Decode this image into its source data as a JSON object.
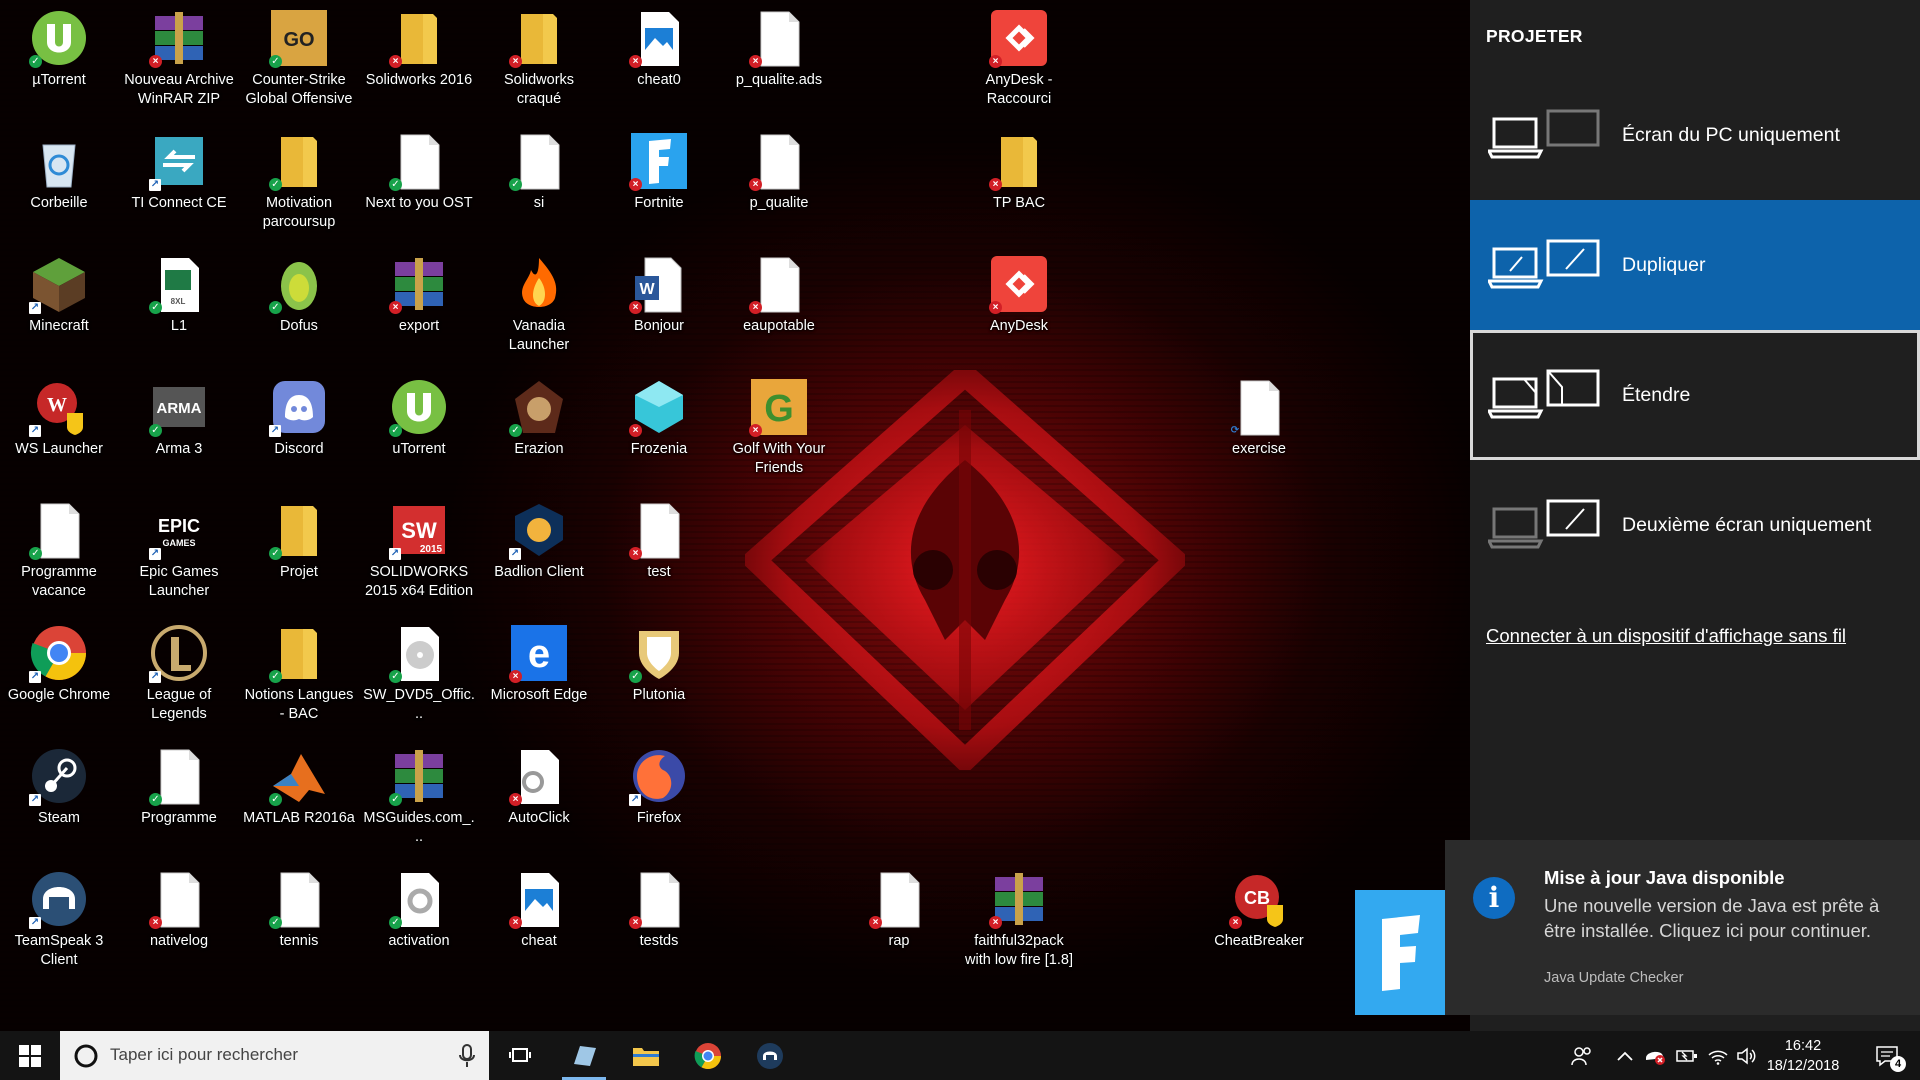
{
  "desktop": {
    "icons": [
      {
        "label": "µTorrent",
        "kind": "utorrent",
        "badge": "ok"
      },
      {
        "label": "Nouveau Archive WinRAR ZIP",
        "kind": "winrar",
        "badge": "err"
      },
      {
        "label": "Counter-Strike Global Offensive",
        "kind": "csgo",
        "badge": "ok"
      },
      {
        "label": "Solidworks 2016",
        "kind": "folder",
        "badge": "err"
      },
      {
        "label": "Solidworks craqué",
        "kind": "folder",
        "badge": "err"
      },
      {
        "label": "cheat0",
        "kind": "image",
        "badge": "err"
      },
      {
        "label": "p_qualite.ads",
        "kind": "doc",
        "badge": "err"
      },
      {
        "label": "AnyDesk - Raccourci",
        "kind": "anydesk",
        "badge": "err"
      },
      {
        "label": "Corbeille",
        "kind": "recycle",
        "badge": ""
      },
      {
        "label": "TI Connect CE",
        "kind": "ticonnect",
        "badge": "sc"
      },
      {
        "label": "Motivation parcoursup",
        "kind": "folder",
        "badge": "ok"
      },
      {
        "label": "Next to you OST",
        "kind": "doc",
        "badge": "ok"
      },
      {
        "label": "si",
        "kind": "doc",
        "badge": "ok"
      },
      {
        "label": "Fortnite",
        "kind": "fortnite",
        "badge": "err"
      },
      {
        "label": "p_qualite",
        "kind": "doc",
        "badge": "err"
      },
      {
        "label": "TP BAC",
        "kind": "folder",
        "badge": "err"
      },
      {
        "label": "Minecraft",
        "kind": "minecraft",
        "badge": "sc"
      },
      {
        "label": "L1",
        "kind": "excel",
        "badge": "ok"
      },
      {
        "label": "Dofus",
        "kind": "dofus",
        "badge": "ok"
      },
      {
        "label": "export",
        "kind": "winrar",
        "badge": "err"
      },
      {
        "label": "Vanadia Launcher",
        "kind": "fire",
        "badge": ""
      },
      {
        "label": "Bonjour",
        "kind": "word",
        "badge": "err"
      },
      {
        "label": "eaupotable",
        "kind": "doc",
        "badge": "err"
      },
      {
        "label": "AnyDesk",
        "kind": "anydesk",
        "badge": "err"
      },
      {
        "label": "WS Launcher",
        "kind": "wslauncher",
        "badge": "sc"
      },
      {
        "label": "Arma 3",
        "kind": "arma",
        "badge": "ok"
      },
      {
        "label": "Discord",
        "kind": "discord",
        "badge": "sc"
      },
      {
        "label": "uTorrent",
        "kind": "utorrent",
        "badge": "ok"
      },
      {
        "label": "Erazion",
        "kind": "erazion",
        "badge": "ok"
      },
      {
        "label": "Frozenia",
        "kind": "frozenia",
        "badge": "err"
      },
      {
        "label": "Golf With Your Friends",
        "kind": "golf",
        "badge": "err"
      },
      {
        "label": "exercise",
        "kind": "doc",
        "badge": "sync"
      },
      {
        "label": "Programme vacance",
        "kind": "doc",
        "badge": "ok"
      },
      {
        "label": "Epic Games Launcher",
        "kind": "epic",
        "badge": "sc"
      },
      {
        "label": "Projet",
        "kind": "folder",
        "badge": "ok"
      },
      {
        "label": "SOLIDWORKS 2015 x64 Edition",
        "kind": "solidworks",
        "badge": "sc"
      },
      {
        "label": "Badlion Client",
        "kind": "badlion",
        "badge": "sc"
      },
      {
        "label": "test",
        "kind": "doc",
        "badge": "err"
      },
      {
        "label": "Google Chrome",
        "kind": "chrome",
        "badge": "sc"
      },
      {
        "label": "League of Legends",
        "kind": "lol",
        "badge": "sc"
      },
      {
        "label": "Notions Langues - BAC",
        "kind": "folder",
        "badge": "ok"
      },
      {
        "label": "SW_DVD5_Offic...",
        "kind": "disc",
        "badge": "ok"
      },
      {
        "label": "Microsoft Edge",
        "kind": "edge",
        "badge": "err"
      },
      {
        "label": "Plutonia",
        "kind": "plutonia",
        "badge": "ok"
      },
      {
        "label": "Steam",
        "kind": "steam",
        "badge": "sc"
      },
      {
        "label": "Programme",
        "kind": "doc",
        "badge": "ok"
      },
      {
        "label": "MATLAB R2016a",
        "kind": "matlab",
        "badge": "ok"
      },
      {
        "label": "MSGuides.com_...",
        "kind": "winrar",
        "badge": "ok"
      },
      {
        "label": "AutoClick",
        "kind": "autoclick",
        "badge": "err"
      },
      {
        "label": "Firefox",
        "kind": "firefox",
        "badge": "sc"
      },
      {
        "label": "TeamSpeak 3 Client",
        "kind": "teamspeak",
        "badge": "sc"
      },
      {
        "label": "nativelog",
        "kind": "doc",
        "badge": "err"
      },
      {
        "label": "tennis",
        "kind": "doc",
        "badge": "ok"
      },
      {
        "label": "activation",
        "kind": "gearfile",
        "badge": "ok"
      },
      {
        "label": "cheat",
        "kind": "image",
        "badge": "err"
      },
      {
        "label": "testds",
        "kind": "doc",
        "badge": "err"
      },
      {
        "label": "rap",
        "kind": "doc",
        "badge": "err"
      },
      {
        "label": "faithful32pack with low fire [1.8]",
        "kind": "winrar",
        "badge": "err"
      },
      {
        "label": "CheatBreaker",
        "kind": "cheatbreaker",
        "badge": "err"
      }
    ]
  },
  "project_panel": {
    "title": "PROJETER",
    "options": [
      {
        "label": "Écran du PC uniquement",
        "state": "normal",
        "icon": "pc-screen-only-icon"
      },
      {
        "label": "Dupliquer",
        "state": "selected",
        "icon": "duplicate-icon"
      },
      {
        "label": "Étendre",
        "state": "focused",
        "icon": "extend-icon"
      },
      {
        "label": "Deuxième écran uniquement",
        "state": "normal",
        "icon": "second-screen-only-icon"
      }
    ],
    "wireless_link": "Connecter à un dispositif d'affichage sans fil"
  },
  "toast": {
    "title": "Mise à jour Java disponible",
    "body": "Une nouvelle version de Java est prête à être installée. Cliquez ici pour continuer.",
    "source": "Java Update Checker",
    "icon": "info-icon"
  },
  "taskbar": {
    "search_placeholder": "Taper ici pour rechercher",
    "pinned": [
      {
        "name": "task-view-icon"
      },
      {
        "name": "app-icon"
      },
      {
        "name": "file-explorer-icon"
      },
      {
        "name": "chrome-icon"
      },
      {
        "name": "teamspeak-icon"
      }
    ],
    "notification_count": "4",
    "time": "16:42",
    "date": "18/12/2018"
  },
  "colors": {
    "accent": "#0d63ab",
    "panel_bg": "#1f1f1f",
    "toast_bg": "#2b2b2b",
    "taskbar_bg": "#141414"
  }
}
